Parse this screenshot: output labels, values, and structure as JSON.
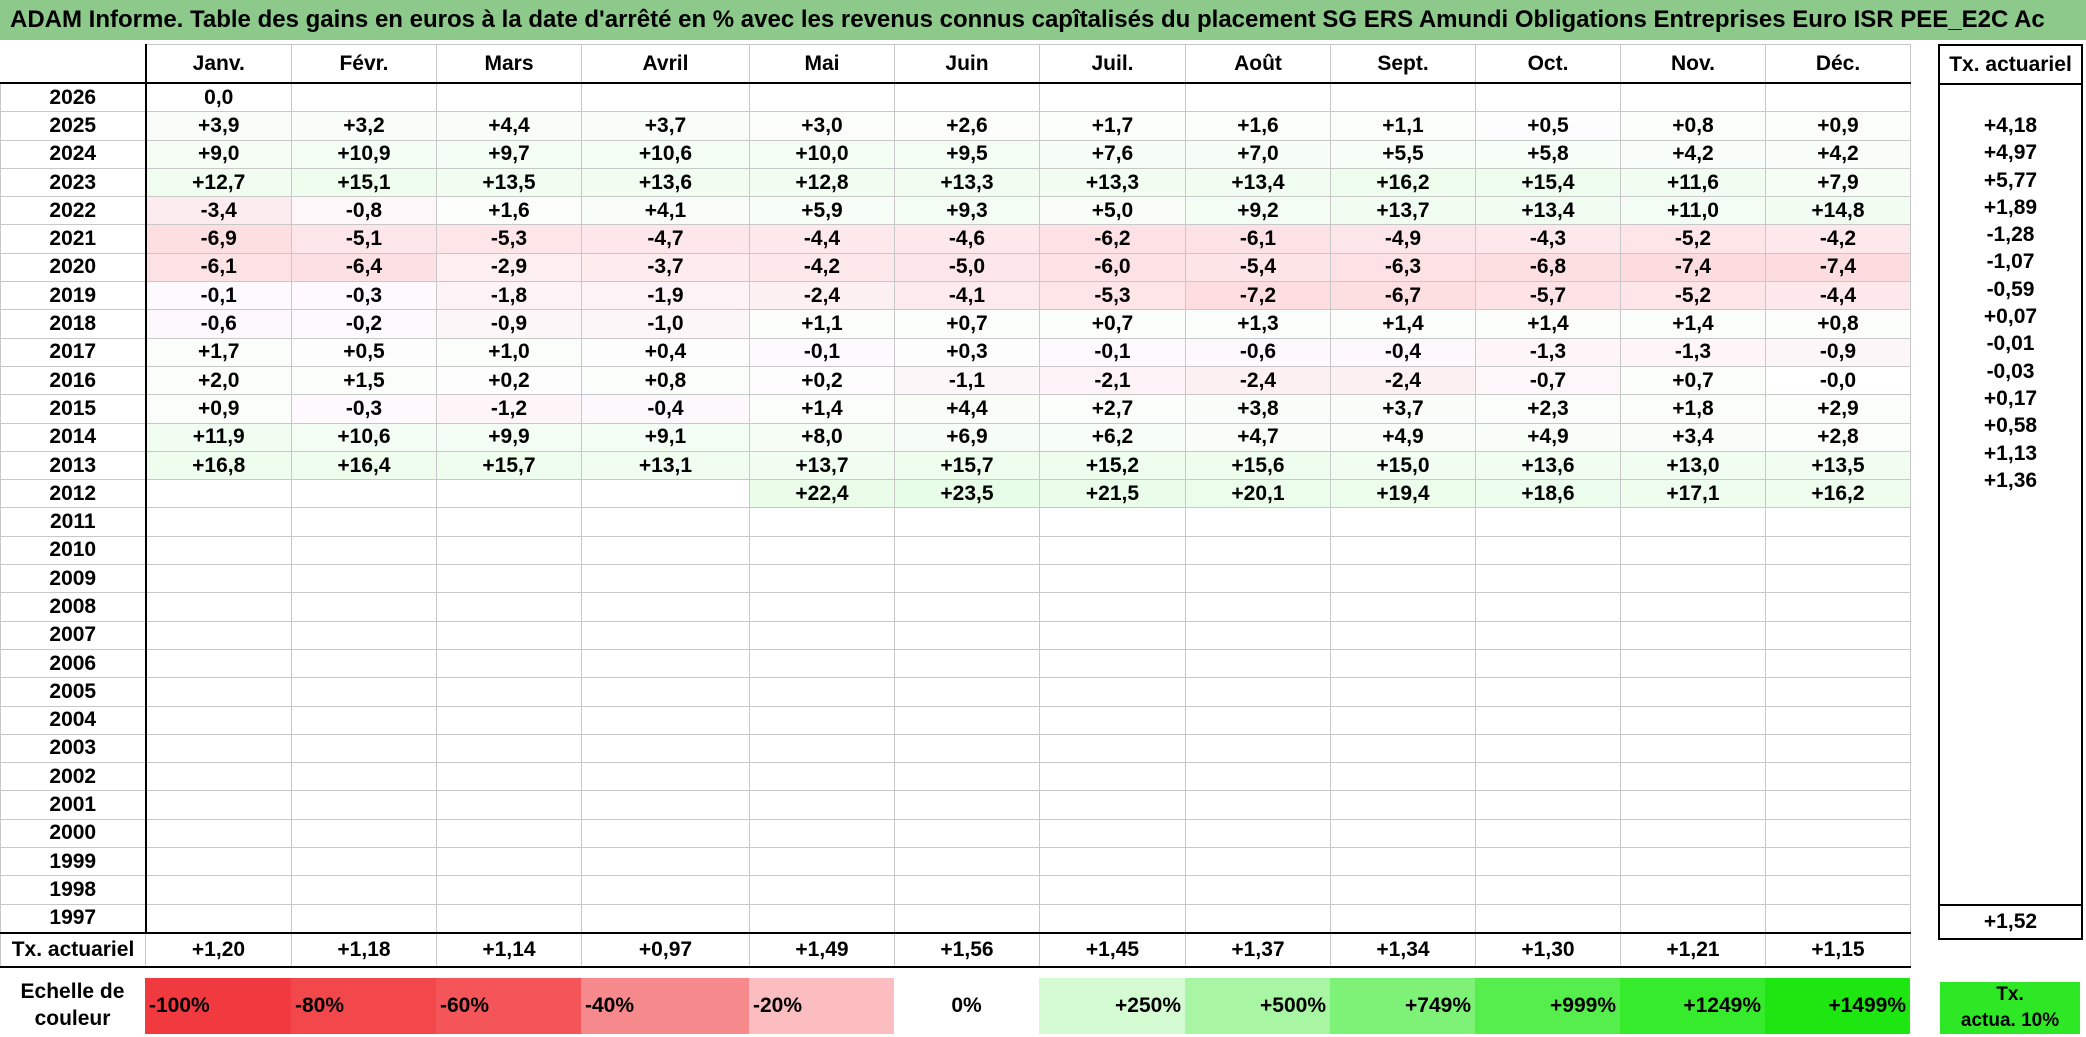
{
  "title": "ADAM Informe. Table des gains en euros à la date d'arrêté en % avec les revenus connus capîtalisés du placement SG ERS Amundi Obligations Entreprises Euro ISR PEE_E2C Ac",
  "months": [
    "Janv.",
    "Févr.",
    "Mars",
    "Avril",
    "Mai",
    "Juin",
    "Juil.",
    "Août",
    "Sept.",
    "Oct.",
    "Nov.",
    "Déc."
  ],
  "rate_header": "Tx. actuariel",
  "rows": [
    {
      "year": "2026",
      "values": [
        "0,0",
        "",
        "",
        "",
        "",
        "",
        "",
        "",
        "",
        "",
        "",
        ""
      ],
      "rate": ""
    },
    {
      "year": "2025",
      "values": [
        "+3,9",
        "+3,2",
        "+4,4",
        "+3,7",
        "+3,0",
        "+2,6",
        "+1,7",
        "+1,6",
        "+1,1",
        "+0,5",
        "+0,8",
        "+0,9"
      ],
      "rate": "+4,18"
    },
    {
      "year": "2024",
      "values": [
        "+9,0",
        "+10,9",
        "+9,7",
        "+10,6",
        "+10,0",
        "+9,5",
        "+7,6",
        "+7,0",
        "+5,5",
        "+5,8",
        "+4,2",
        "+4,2"
      ],
      "rate": "+4,97"
    },
    {
      "year": "2023",
      "values": [
        "+12,7",
        "+15,1",
        "+13,5",
        "+13,6",
        "+12,8",
        "+13,3",
        "+13,3",
        "+13,4",
        "+16,2",
        "+15,4",
        "+11,6",
        "+7,9"
      ],
      "rate": "+5,77"
    },
    {
      "year": "2022",
      "values": [
        "-3,4",
        "-0,8",
        "+1,6",
        "+4,1",
        "+5,9",
        "+9,3",
        "+5,0",
        "+9,2",
        "+13,7",
        "+13,4",
        "+11,0",
        "+14,8"
      ],
      "rate": "+1,89"
    },
    {
      "year": "2021",
      "values": [
        "-6,9",
        "-5,1",
        "-5,3",
        "-4,7",
        "-4,4",
        "-4,6",
        "-6,2",
        "-6,1",
        "-4,9",
        "-4,3",
        "-5,2",
        "-4,2"
      ],
      "rate": "-1,28"
    },
    {
      "year": "2020",
      "values": [
        "-6,1",
        "-6,4",
        "-2,9",
        "-3,7",
        "-4,2",
        "-5,0",
        "-6,0",
        "-5,4",
        "-6,3",
        "-6,8",
        "-7,4",
        "-7,4"
      ],
      "rate": "-1,07"
    },
    {
      "year": "2019",
      "values": [
        "-0,1",
        "-0,3",
        "-1,8",
        "-1,9",
        "-2,4",
        "-4,1",
        "-5,3",
        "-7,2",
        "-6,7",
        "-5,7",
        "-5,2",
        "-4,4"
      ],
      "rate": "-0,59"
    },
    {
      "year": "2018",
      "values": [
        "-0,6",
        "-0,2",
        "-0,9",
        "-1,0",
        "+1,1",
        "+0,7",
        "+0,7",
        "+1,3",
        "+1,4",
        "+1,4",
        "+1,4",
        "+0,8"
      ],
      "rate": "+0,07"
    },
    {
      "year": "2017",
      "values": [
        "+1,7",
        "+0,5",
        "+1,0",
        "+0,4",
        "-0,1",
        "+0,3",
        "-0,1",
        "-0,6",
        "-0,4",
        "-1,3",
        "-1,3",
        "-0,9"
      ],
      "rate": "-0,01"
    },
    {
      "year": "2016",
      "values": [
        "+2,0",
        "+1,5",
        "+0,2",
        "+0,8",
        "+0,2",
        "-1,1",
        "-2,1",
        "-2,4",
        "-2,4",
        "-0,7",
        "+0,7",
        "-0,0"
      ],
      "rate": "-0,03"
    },
    {
      "year": "2015",
      "values": [
        "+0,9",
        "-0,3",
        "-1,2",
        "-0,4",
        "+1,4",
        "+4,4",
        "+2,7",
        "+3,8",
        "+3,7",
        "+2,3",
        "+1,8",
        "+2,9"
      ],
      "rate": "+0,17"
    },
    {
      "year": "2014",
      "values": [
        "+11,9",
        "+10,6",
        "+9,9",
        "+9,1",
        "+8,0",
        "+6,9",
        "+6,2",
        "+4,7",
        "+4,9",
        "+4,9",
        "+3,4",
        "+2,8"
      ],
      "rate": "+0,58"
    },
    {
      "year": "2013",
      "values": [
        "+16,8",
        "+16,4",
        "+15,7",
        "+13,1",
        "+13,7",
        "+15,7",
        "+15,2",
        "+15,6",
        "+15,0",
        "+13,6",
        "+13,0",
        "+13,5"
      ],
      "rate": "+1,13"
    },
    {
      "year": "2012",
      "values": [
        "",
        "",
        "",
        "",
        "+22,4",
        "+23,5",
        "+21,5",
        "+20,1",
        "+19,4",
        "+18,6",
        "+17,1",
        "+16,2"
      ],
      "rate": "+1,36"
    },
    {
      "year": "2011",
      "values": [
        "",
        "",
        "",
        "",
        "",
        "",
        "",
        "",
        "",
        "",
        "",
        ""
      ],
      "rate": ""
    },
    {
      "year": "2010",
      "values": [
        "",
        "",
        "",
        "",
        "",
        "",
        "",
        "",
        "",
        "",
        "",
        ""
      ],
      "rate": ""
    },
    {
      "year": "2009",
      "values": [
        "",
        "",
        "",
        "",
        "",
        "",
        "",
        "",
        "",
        "",
        "",
        ""
      ],
      "rate": ""
    },
    {
      "year": "2008",
      "values": [
        "",
        "",
        "",
        "",
        "",
        "",
        "",
        "",
        "",
        "",
        "",
        ""
      ],
      "rate": ""
    },
    {
      "year": "2007",
      "values": [
        "",
        "",
        "",
        "",
        "",
        "",
        "",
        "",
        "",
        "",
        "",
        ""
      ],
      "rate": ""
    },
    {
      "year": "2006",
      "values": [
        "",
        "",
        "",
        "",
        "",
        "",
        "",
        "",
        "",
        "",
        "",
        ""
      ],
      "rate": ""
    },
    {
      "year": "2005",
      "values": [
        "",
        "",
        "",
        "",
        "",
        "",
        "",
        "",
        "",
        "",
        "",
        ""
      ],
      "rate": ""
    },
    {
      "year": "2004",
      "values": [
        "",
        "",
        "",
        "",
        "",
        "",
        "",
        "",
        "",
        "",
        "",
        ""
      ],
      "rate": ""
    },
    {
      "year": "2003",
      "values": [
        "",
        "",
        "",
        "",
        "",
        "",
        "",
        "",
        "",
        "",
        "",
        ""
      ],
      "rate": ""
    },
    {
      "year": "2002",
      "values": [
        "",
        "",
        "",
        "",
        "",
        "",
        "",
        "",
        "",
        "",
        "",
        ""
      ],
      "rate": ""
    },
    {
      "year": "2001",
      "values": [
        "",
        "",
        "",
        "",
        "",
        "",
        "",
        "",
        "",
        "",
        "",
        ""
      ],
      "rate": ""
    },
    {
      "year": "2000",
      "values": [
        "",
        "",
        "",
        "",
        "",
        "",
        "",
        "",
        "",
        "",
        "",
        ""
      ],
      "rate": ""
    },
    {
      "year": "1999",
      "values": [
        "",
        "",
        "",
        "",
        "",
        "",
        "",
        "",
        "",
        "",
        "",
        ""
      ],
      "rate": ""
    },
    {
      "year": "1998",
      "values": [
        "",
        "",
        "",
        "",
        "",
        "",
        "",
        "",
        "",
        "",
        "",
        ""
      ],
      "rate": ""
    },
    {
      "year": "1997",
      "values": [
        "",
        "",
        "",
        "",
        "",
        "",
        "",
        "",
        "",
        "",
        "",
        ""
      ],
      "rate": ""
    }
  ],
  "footer": {
    "label": "Tx. actuariel",
    "values": [
      "+1,20",
      "+1,18",
      "+1,14",
      "+0,97",
      "+1,49",
      "+1,56",
      "+1,45",
      "+1,37",
      "+1,34",
      "+1,30",
      "+1,21",
      "+1,15"
    ],
    "rate": "+1,52"
  },
  "scale": {
    "label_line1": "Echelle de",
    "label_line2": "couleur",
    "items": [
      {
        "text": "-100%",
        "color": "#f03a3f",
        "kind": "neg"
      },
      {
        "text": "-80%",
        "color": "#f2474b",
        "kind": "neg"
      },
      {
        "text": "-60%",
        "color": "#f45558",
        "kind": "neg"
      },
      {
        "text": "-40%",
        "color": "#f6898c",
        "kind": "neg"
      },
      {
        "text": "-20%",
        "color": "#fbbdbf",
        "kind": "neg"
      },
      {
        "text": "0%",
        "color": "#ffffff",
        "kind": "zero"
      },
      {
        "text": "+250%",
        "color": "#d5fbd3",
        "kind": "pos"
      },
      {
        "text": "+500%",
        "color": "#a8f5a4",
        "kind": "pos"
      },
      {
        "text": "+749%",
        "color": "#7ef277",
        "kind": "pos"
      },
      {
        "text": "+999%",
        "color": "#55ee4c",
        "kind": "pos"
      },
      {
        "text": "+1249%",
        "color": "#35eb2b",
        "kind": "pos"
      },
      {
        "text": "+1499%",
        "color": "#1ee611",
        "kind": "pos"
      }
    ],
    "rate_legend_line1": "Tx.",
    "rate_legend_line2": "actua. 10%"
  }
}
